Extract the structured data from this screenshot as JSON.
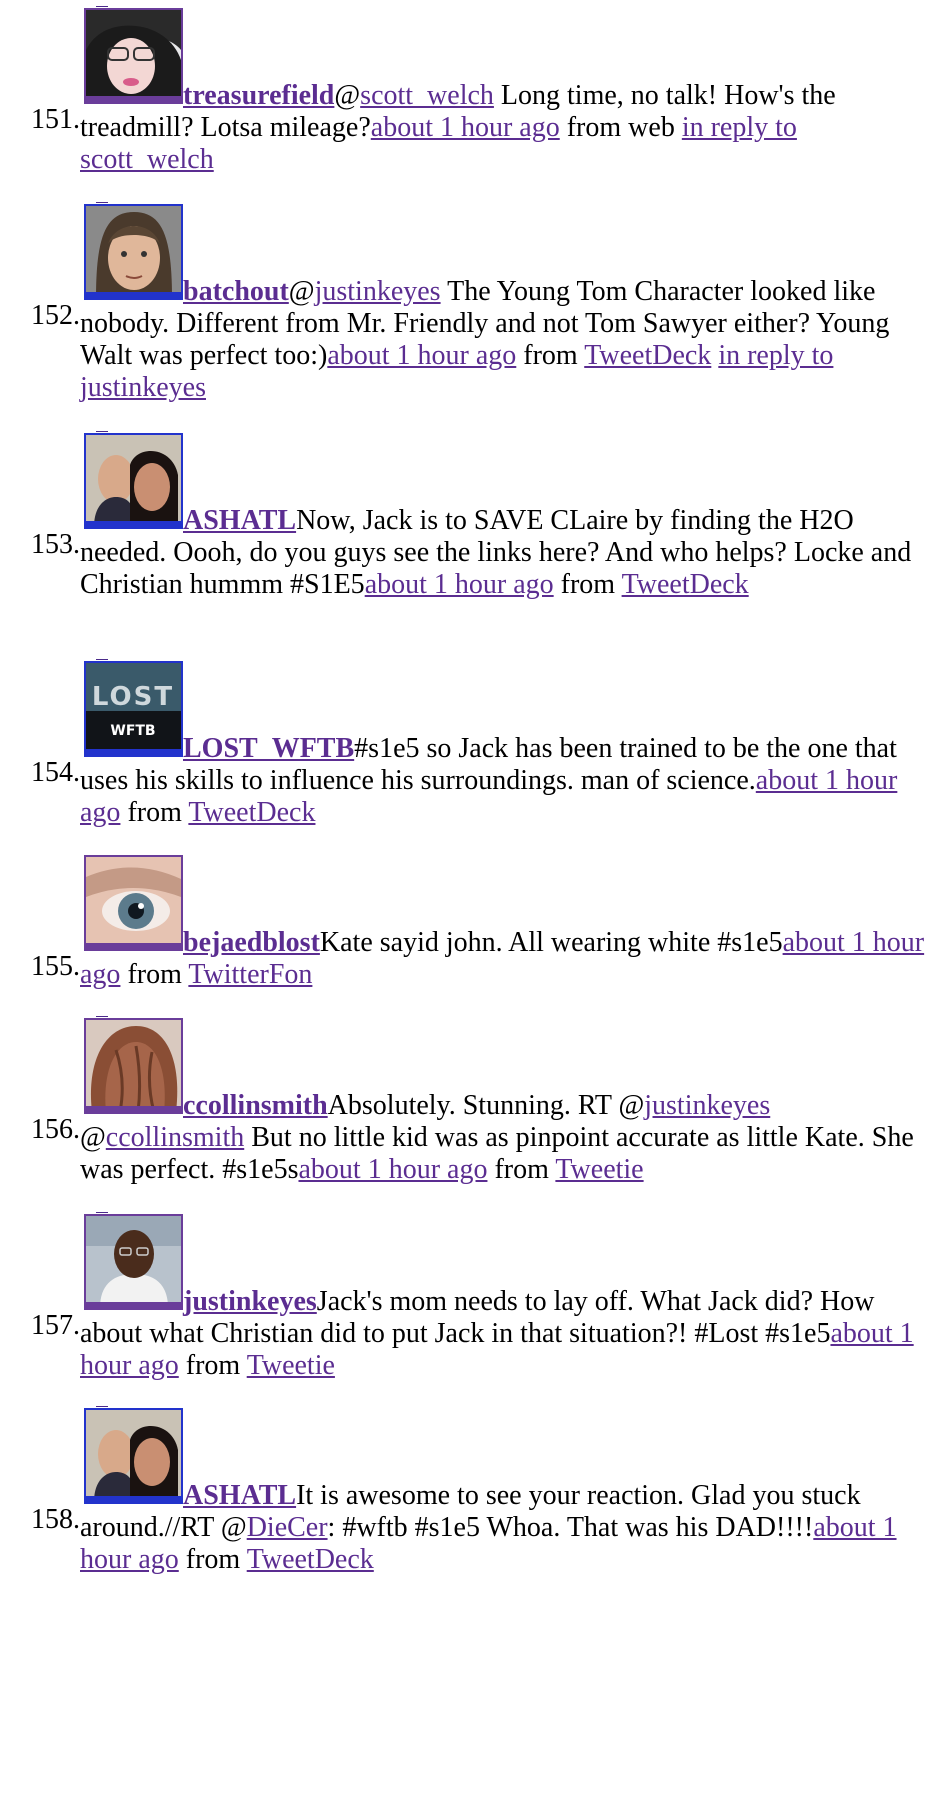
{
  "colors": {
    "link": "#5b2d91",
    "border_blue": "#2233cc",
    "border_purple": "#6a3d9a"
  },
  "tweets": [
    {
      "num": "151.",
      "user": "treasurefield",
      "segs": [
        "@",
        {
          "l": "scott_welch"
        },
        " Long time, no talk! How's the treadmill? Lotsa mileage?"
      ],
      "time": "about 1 hour ago",
      "via": "web",
      "reply_to": "in reply to scott_welch"
    },
    {
      "num": "152.",
      "user": "batchout",
      "segs": [
        "@",
        {
          "l": "justinkeyes"
        },
        " The Young Tom Character looked like nobody. Different from Mr. Friendly and not Tom Sawyer either? Young Walt was perfect too:)"
      ],
      "time": "about 1 hour ago",
      "via_link": "TweetDeck",
      "reply_to": "in reply to justinkeyes"
    },
    {
      "num": "153.",
      "user": "ASHATL",
      "segs": [
        "Now, Jack is to SAVE CLaire by finding the H2O needed. Oooh, do you guys see the links here? And who helps? Locke and Christian hummm #S1E5"
      ],
      "time": "about 1 hour ago",
      "via_link": "TweetDeck"
    },
    {
      "num": "154.",
      "user": "LOST_WFTB",
      "segs": [
        "#s1e5 so Jack has been trained to be the one that uses his skills to influence his surroundings. man of science."
      ],
      "time": "about 1 hour ago",
      "via_link": "TweetDeck"
    },
    {
      "num": "155.",
      "user": "bejaedblost",
      "segs": [
        "Kate sayid john. All wearing white #s1e5"
      ],
      "time": "about 1 hour ago",
      "via_link": "TwitterFon"
    },
    {
      "num": "156.",
      "user": "ccollinsmith",
      "segs": [
        "Absolutely. Stunning. RT @",
        {
          "l": "justinkeyes"
        },
        " @",
        {
          "l": "ccollinsmith"
        },
        " But no little kid was as pinpoint accurate as little Kate. She was perfect. #s1e5s"
      ],
      "time": "about 1 hour ago",
      "via_link": "Tweetie"
    },
    {
      "num": "157.",
      "user": "justinkeyes",
      "segs": [
        "Jack's mom needs to lay off. What Jack did? How about what Christian did to put Jack in that situation?! #Lost #s1e5"
      ],
      "time": "about 1 hour ago",
      "via_link": "Tweetie"
    },
    {
      "num": "158.",
      "user": "ASHATL",
      "segs": [
        "It is awesome to see your reaction. Glad you stuck around.//RT @",
        {
          "l": "DieCer"
        },
        ": #wftb #s1e5 Whoa. That was his DAD!!!!"
      ],
      "time": "about 1 hour ago",
      "via_link": "TweetDeck"
    }
  ],
  "from_label": "from"
}
